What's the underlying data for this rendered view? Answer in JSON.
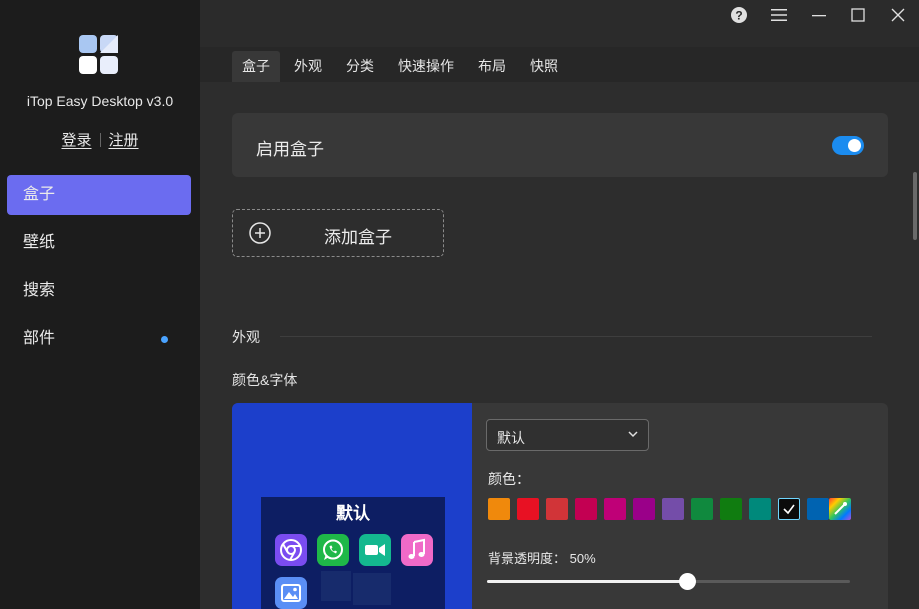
{
  "app": {
    "title": "iTop Easy Desktop v3.0",
    "login": "登录",
    "register": "注册",
    "logo_colors": [
      "#a9c7f2",
      "#e9eefb",
      "#ffffff",
      "#cfdcf7"
    ]
  },
  "sidebar": {
    "items": [
      {
        "label": "盒子",
        "active": true
      },
      {
        "label": "壁纸",
        "active": false
      },
      {
        "label": "搜索",
        "active": false
      },
      {
        "label": "部件",
        "active": false,
        "badge_dot": true
      }
    ]
  },
  "titlebar": {
    "icons": [
      "help-icon",
      "menu-icon",
      "minimize-icon",
      "maximize-icon",
      "close-icon"
    ]
  },
  "tabs": [
    {
      "label": "盒子",
      "active": true
    },
    {
      "label": "外观",
      "active": false
    },
    {
      "label": "分类",
      "active": false
    },
    {
      "label": "快速操作",
      "active": false
    },
    {
      "label": "布局",
      "active": false
    },
    {
      "label": "快照",
      "active": false
    }
  ],
  "main": {
    "enable_label": "启用盒子",
    "enable_on": true,
    "add_box_label": "添加盒子",
    "section_appearance": "外观",
    "color_font_label": "颜色&字体"
  },
  "preview": {
    "box_title": "默认",
    "background": "#1c3fcb",
    "apps": [
      "chrome-icon",
      "whatsapp-icon",
      "facetime-icon",
      "music-icon",
      "photos-icon"
    ]
  },
  "appearance": {
    "theme_select": "默认",
    "color_label": "颜色：",
    "swatches": [
      "#f0890c",
      "#e81123",
      "#d13438",
      "#c30052",
      "#bf0077",
      "#9a0089",
      "#744da9",
      "#10893e",
      "#107c10",
      "#00897b",
      "#000000",
      "#0063b1",
      "rainbow"
    ],
    "selected_swatch": 10,
    "opacity_label": "背景透明度：",
    "opacity_value": "50%",
    "opacity_fraction": 0.55
  }
}
